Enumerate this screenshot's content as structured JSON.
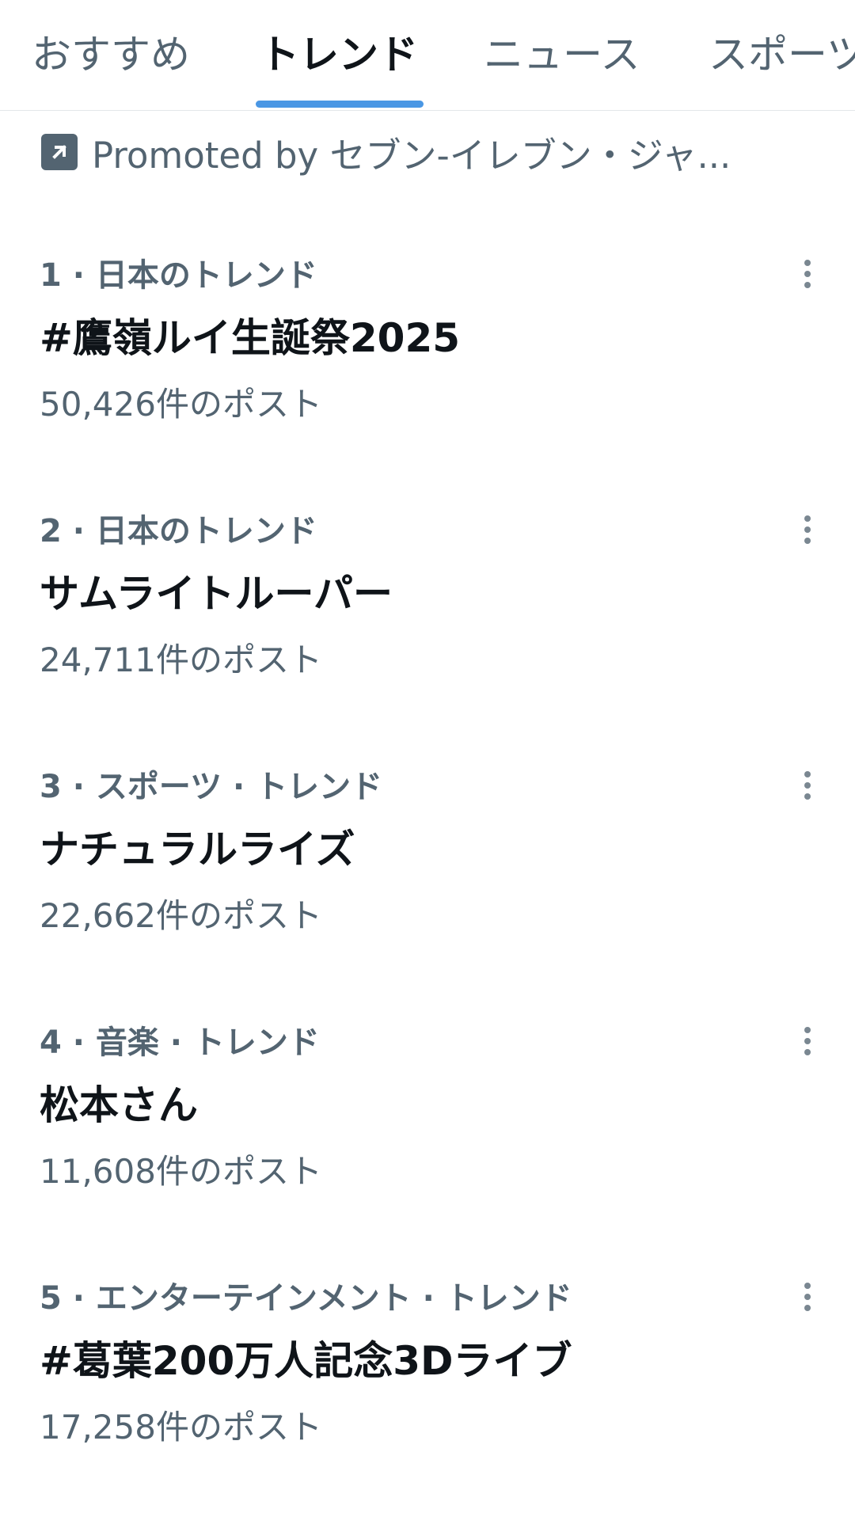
{
  "tabs": [
    {
      "label": "おすすめ",
      "active": false
    },
    {
      "label": "トレンド",
      "active": true
    },
    {
      "label": "ニュース",
      "active": false
    },
    {
      "label": "スポーツ",
      "active": false
    }
  ],
  "promoted": {
    "icon": "promoted-arrow-icon",
    "text": "Promoted by セブン‐イレブン・ジャ..."
  },
  "trends": [
    {
      "meta": "1 · 日本のトレンド",
      "name": "#鷹嶺ルイ生誕祭2025",
      "count": "50,426件のポスト"
    },
    {
      "meta": "2 · 日本のトレンド",
      "name": "サムライトルーパー",
      "count": "24,711件のポスト"
    },
    {
      "meta": "3 · スポーツ · トレンド",
      "name": "ナチュラルライズ",
      "count": "22,662件のポスト"
    },
    {
      "meta": "4 · 音楽 · トレンド",
      "name": "松本さん",
      "count": "11,608件のポスト"
    },
    {
      "meta": "5 · エンターテインメント · トレンド",
      "name": "#葛葉200万人記念3Dライブ",
      "count": "17,258件のポスト"
    }
  ],
  "colors": {
    "accent": "#4a97e4",
    "primary_text": "#0f1419",
    "secondary_text": "#536471",
    "divider": "#e3e7ea"
  }
}
